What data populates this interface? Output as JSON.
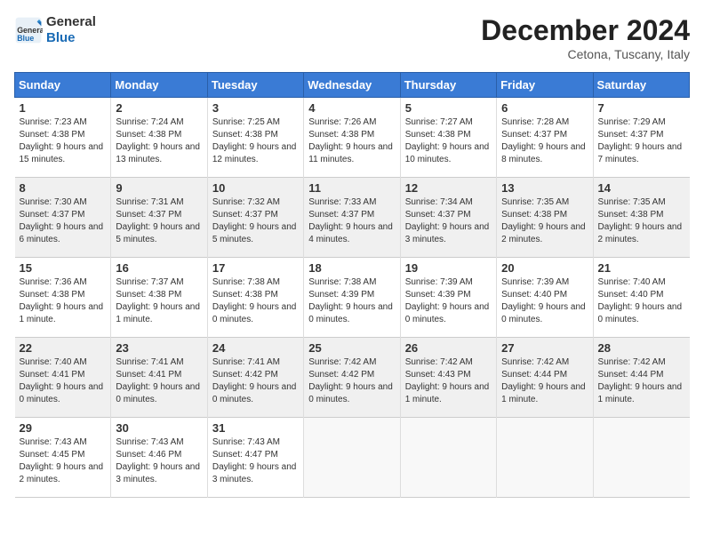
{
  "header": {
    "logo_general": "General",
    "logo_blue": "Blue",
    "month": "December 2024",
    "location": "Cetona, Tuscany, Italy"
  },
  "days_of_week": [
    "Sunday",
    "Monday",
    "Tuesday",
    "Wednesday",
    "Thursday",
    "Friday",
    "Saturday"
  ],
  "weeks": [
    [
      {
        "day": "1",
        "sunrise": "7:23 AM",
        "sunset": "4:38 PM",
        "daylight": "9 hours and 15 minutes."
      },
      {
        "day": "2",
        "sunrise": "7:24 AM",
        "sunset": "4:38 PM",
        "daylight": "9 hours and 13 minutes."
      },
      {
        "day": "3",
        "sunrise": "7:25 AM",
        "sunset": "4:38 PM",
        "daylight": "9 hours and 12 minutes."
      },
      {
        "day": "4",
        "sunrise": "7:26 AM",
        "sunset": "4:38 PM",
        "daylight": "9 hours and 11 minutes."
      },
      {
        "day": "5",
        "sunrise": "7:27 AM",
        "sunset": "4:38 PM",
        "daylight": "9 hours and 10 minutes."
      },
      {
        "day": "6",
        "sunrise": "7:28 AM",
        "sunset": "4:37 PM",
        "daylight": "9 hours and 8 minutes."
      },
      {
        "day": "7",
        "sunrise": "7:29 AM",
        "sunset": "4:37 PM",
        "daylight": "9 hours and 7 minutes."
      }
    ],
    [
      {
        "day": "8",
        "sunrise": "7:30 AM",
        "sunset": "4:37 PM",
        "daylight": "9 hours and 6 minutes."
      },
      {
        "day": "9",
        "sunrise": "7:31 AM",
        "sunset": "4:37 PM",
        "daylight": "9 hours and 5 minutes."
      },
      {
        "day": "10",
        "sunrise": "7:32 AM",
        "sunset": "4:37 PM",
        "daylight": "9 hours and 5 minutes."
      },
      {
        "day": "11",
        "sunrise": "7:33 AM",
        "sunset": "4:37 PM",
        "daylight": "9 hours and 4 minutes."
      },
      {
        "day": "12",
        "sunrise": "7:34 AM",
        "sunset": "4:37 PM",
        "daylight": "9 hours and 3 minutes."
      },
      {
        "day": "13",
        "sunrise": "7:35 AM",
        "sunset": "4:38 PM",
        "daylight": "9 hours and 2 minutes."
      },
      {
        "day": "14",
        "sunrise": "7:35 AM",
        "sunset": "4:38 PM",
        "daylight": "9 hours and 2 minutes."
      }
    ],
    [
      {
        "day": "15",
        "sunrise": "7:36 AM",
        "sunset": "4:38 PM",
        "daylight": "9 hours and 1 minute."
      },
      {
        "day": "16",
        "sunrise": "7:37 AM",
        "sunset": "4:38 PM",
        "daylight": "9 hours and 1 minute."
      },
      {
        "day": "17",
        "sunrise": "7:38 AM",
        "sunset": "4:38 PM",
        "daylight": "9 hours and 0 minutes."
      },
      {
        "day": "18",
        "sunrise": "7:38 AM",
        "sunset": "4:39 PM",
        "daylight": "9 hours and 0 minutes."
      },
      {
        "day": "19",
        "sunrise": "7:39 AM",
        "sunset": "4:39 PM",
        "daylight": "9 hours and 0 minutes."
      },
      {
        "day": "20",
        "sunrise": "7:39 AM",
        "sunset": "4:40 PM",
        "daylight": "9 hours and 0 minutes."
      },
      {
        "day": "21",
        "sunrise": "7:40 AM",
        "sunset": "4:40 PM",
        "daylight": "9 hours and 0 minutes."
      }
    ],
    [
      {
        "day": "22",
        "sunrise": "7:40 AM",
        "sunset": "4:41 PM",
        "daylight": "9 hours and 0 minutes."
      },
      {
        "day": "23",
        "sunrise": "7:41 AM",
        "sunset": "4:41 PM",
        "daylight": "9 hours and 0 minutes."
      },
      {
        "day": "24",
        "sunrise": "7:41 AM",
        "sunset": "4:42 PM",
        "daylight": "9 hours and 0 minutes."
      },
      {
        "day": "25",
        "sunrise": "7:42 AM",
        "sunset": "4:42 PM",
        "daylight": "9 hours and 0 minutes."
      },
      {
        "day": "26",
        "sunrise": "7:42 AM",
        "sunset": "4:43 PM",
        "daylight": "9 hours and 1 minute."
      },
      {
        "day": "27",
        "sunrise": "7:42 AM",
        "sunset": "4:44 PM",
        "daylight": "9 hours and 1 minute."
      },
      {
        "day": "28",
        "sunrise": "7:42 AM",
        "sunset": "4:44 PM",
        "daylight": "9 hours and 1 minute."
      }
    ],
    [
      {
        "day": "29",
        "sunrise": "7:43 AM",
        "sunset": "4:45 PM",
        "daylight": "9 hours and 2 minutes."
      },
      {
        "day": "30",
        "sunrise": "7:43 AM",
        "sunset": "4:46 PM",
        "daylight": "9 hours and 3 minutes."
      },
      {
        "day": "31",
        "sunrise": "7:43 AM",
        "sunset": "4:47 PM",
        "daylight": "9 hours and 3 minutes."
      },
      null,
      null,
      null,
      null
    ]
  ]
}
